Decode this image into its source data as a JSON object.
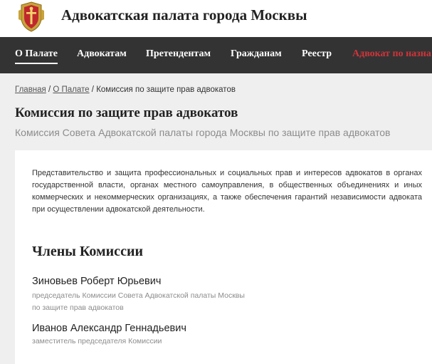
{
  "header": {
    "site_title": "Адвокатская палата города Москвы",
    "logo_icon": "coat-of-arms-icon"
  },
  "nav": {
    "items": [
      {
        "label": "О Палате",
        "active": true
      },
      {
        "label": "Адвокатам"
      },
      {
        "label": "Претендентам"
      },
      {
        "label": "Гражданам"
      },
      {
        "label": "Реестр"
      },
      {
        "label": "Адвокат по назна",
        "highlight": true
      }
    ]
  },
  "breadcrumb": {
    "home": "Главная",
    "sep1": "/",
    "section": "О Палате",
    "sep2": "/",
    "current": "Комиссия по защите прав адвокатов"
  },
  "page": {
    "title": "Комиссия по защите прав адвокатов",
    "subtitle": "Комиссия Совета Адвокатской палаты города Москвы по защите прав адвокатов",
    "description": "Представительство и защита профессиональных и социальных прав и интересов адвокатов в органах государственной власти, органах местного самоуправления, в общественных объединениях и иных коммерческих и некоммерческих организациях, а также обеспечения гарантий независимости адвоката при осуществлении адвокатской деятельности."
  },
  "members": {
    "heading": "Члены Комиссии",
    "list": [
      {
        "name": "Зиновьев Роберт Юрьевич",
        "role_line1": "председатель Комиссии Совета Адвокатской палаты Москвы",
        "role_line2": "по защите прав адвокатов"
      },
      {
        "name": "Иванов Александр Геннадьевич",
        "role_line1": "заместитель председателя Комиссии"
      }
    ]
  },
  "colors": {
    "nav_bg": "#333333",
    "accent": "#d0343a",
    "page_bg": "#efefef",
    "muted_text": "#8c8c8c"
  }
}
